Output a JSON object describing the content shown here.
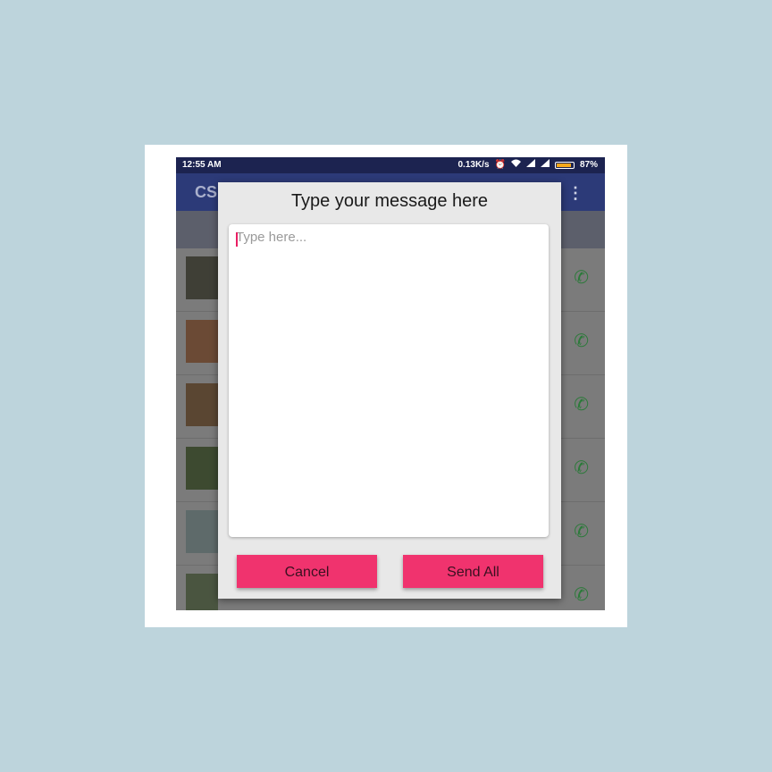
{
  "statusbar": {
    "time": "12:55 AM",
    "network_speed": "0.13K/s",
    "battery": "87%",
    "battery_level": 0.87,
    "icons": [
      "alarm-icon",
      "wifi-icon",
      "signal-icon",
      "signal-icon",
      "battery-icon"
    ]
  },
  "appbar": {
    "title": "CS",
    "menu_icon": "more-vert-icon"
  },
  "contact_rows": [
    {
      "icon": "call-icon"
    },
    {
      "icon": "call-icon"
    },
    {
      "icon": "call-icon"
    },
    {
      "icon": "call-icon"
    },
    {
      "icon": "call-icon"
    },
    {
      "icon": "call-icon"
    }
  ],
  "dialog": {
    "title": "Type your message here",
    "input": {
      "value": "",
      "placeholder": "Type here..."
    },
    "cancel_label": "Cancel",
    "send_label": "Send All"
  },
  "colors": {
    "background": "#bdd4dc",
    "statusbar": "#1c2350",
    "appbar": "#2c3a78",
    "accent_button": "#f0336e",
    "caret": "#e91e63"
  }
}
